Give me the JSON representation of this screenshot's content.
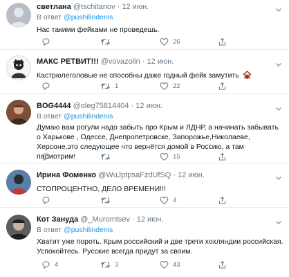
{
  "tweets": [
    {
      "name": "светлана",
      "handle": "@tschitanov",
      "date": "12 июн.",
      "reply_prefix": "В ответ",
      "reply_to": "@pushilindenis",
      "text": "Нас такими фейками не проведешь.",
      "replies": "",
      "retweets": "",
      "likes": "26"
    },
    {
      "name": "МАКС РЕТВИТ!!!",
      "handle": "@vovazolin",
      "date": "12 июн.",
      "text": "Кастрюлеголовые не способны даже годный фейк замутить",
      "replies": "",
      "retweets": "1",
      "likes": "22"
    },
    {
      "name": "BOG4444",
      "handle": "@oleg75814404",
      "date": "12 июн.",
      "reply_prefix": "В ответ",
      "reply_to": "@pushilindenis",
      "text": "Думаю вам рогули надо забыть про Крым и ЛДНР, а начинать забывать о Харькове , Одессе, Днепропетровске, Запорожье,Николаеве, Херсоне,это следующее что вернётся домой в Россию, а там посмотрим!",
      "replies": "",
      "retweets": "",
      "likes": "15"
    },
    {
      "name": "Ирина Фоменко",
      "handle": "@WuJptpsaFzdUfSQ",
      "date": "12 июн.",
      "text": "СТОПРОЦЕНТНО, ДЕЛО ВРЕМЕНИ!!!",
      "replies": "",
      "retweets": "",
      "likes": "4"
    },
    {
      "name": "Кот Зануда",
      "handle": "@_Muromtsev",
      "date": "12 июн.",
      "reply_prefix": "В ответ",
      "reply_to": "@pushilindenis",
      "text": "Хватит уже пороть. Крым российский и две трети хохляндии российская. Успокойтесь. Русские всегда придут за своим.",
      "replies": "4",
      "retweets": "3",
      "likes": "43"
    }
  ],
  "colors": {
    "accent": "#1b95e0",
    "muted": "#657786",
    "divider": "#e6ecf0"
  },
  "icons": {
    "reply": "reply-icon",
    "retweet": "retweet-icon",
    "like": "heart-icon",
    "share": "share-icon",
    "more": "chevron-down-icon"
  }
}
